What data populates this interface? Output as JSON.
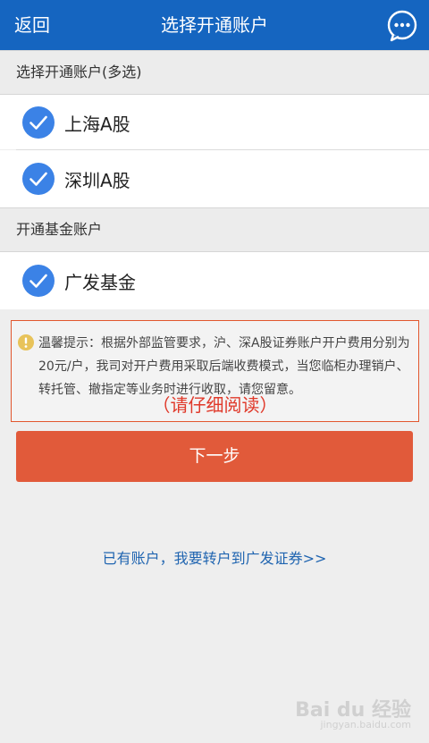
{
  "header": {
    "back_label": "返回",
    "title": "选择开通账户",
    "chat_icon": "chat-bubble-icon"
  },
  "stock_section": {
    "title": "选择开通账户(多选)",
    "options": [
      {
        "label": "上海A股",
        "checked": true
      },
      {
        "label": "深圳A股",
        "checked": true
      }
    ]
  },
  "fund_section": {
    "title": "开通基金账户",
    "options": [
      {
        "label": "广发基金",
        "checked": true
      }
    ]
  },
  "notice": {
    "icon": "info-icon",
    "text": "温馨提示：根据外部监管要求，沪、深A股证券账户开户费用分别为20元/户，我司对开户费用采取后端收费模式，当您临柜办理销户、转托管、撤指定等业务时进行收取，请您留意。",
    "emphasis": "（请仔细阅读）"
  },
  "next_button_label": "下一步",
  "transfer_link": "已有账户，我要转户到广发证券>>",
  "watermark": {
    "logo": "Bai du 经验",
    "sub": "jingyan.baidu.com"
  },
  "colors": {
    "header_bg": "#1565c0",
    "check_blue": "#3b82e6",
    "accent_red": "#e15a3a",
    "link_blue": "#1f64b0"
  }
}
